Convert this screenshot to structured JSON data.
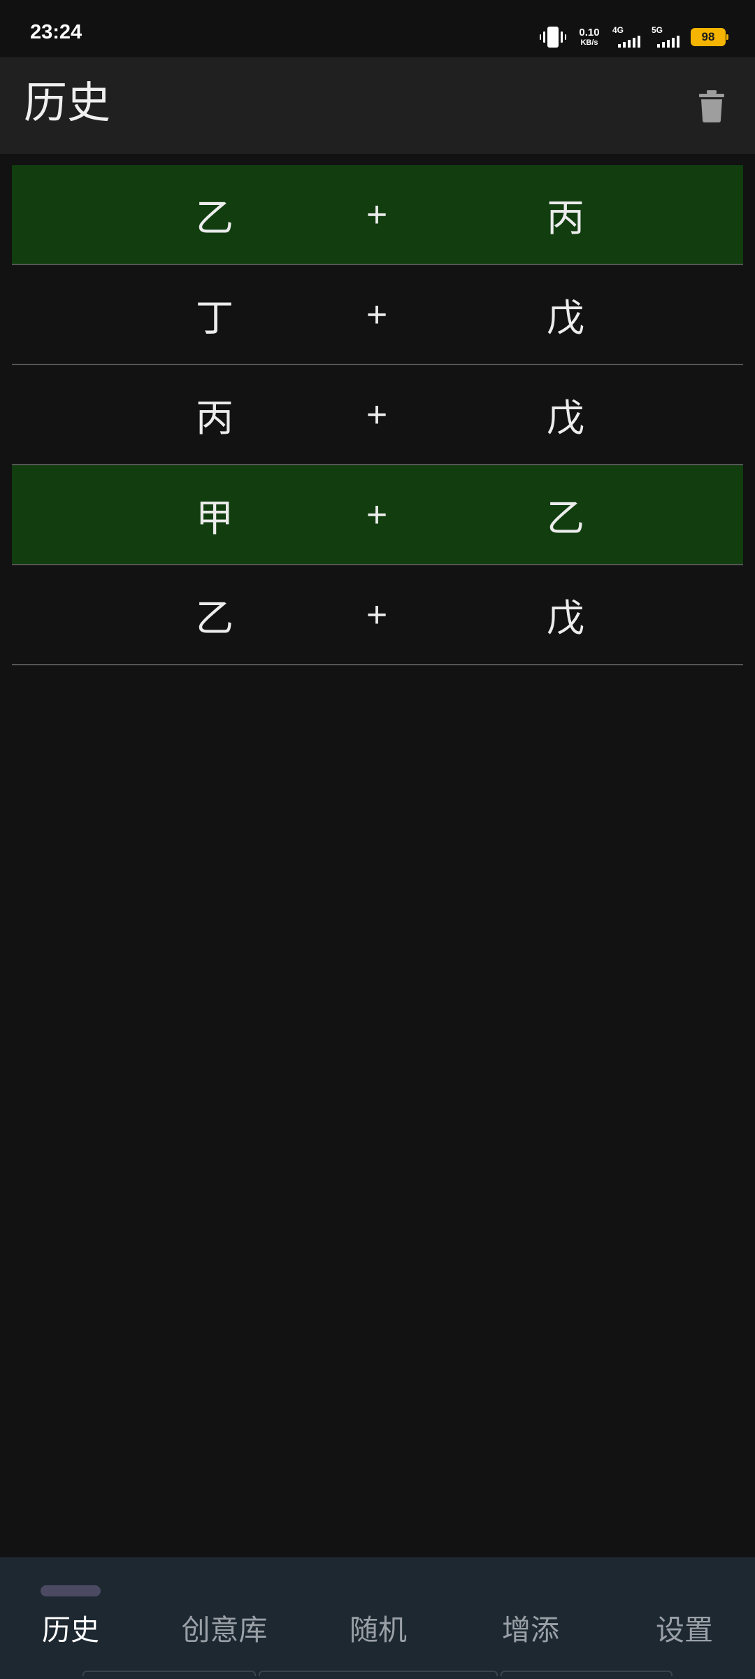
{
  "status_bar": {
    "time": "23:24",
    "net_speed_value": "0.10",
    "net_speed_unit": "KB/s",
    "signal_1_label": "4G",
    "signal_2_label": "5G",
    "battery_level": "98",
    "battery_color": "#f5b400",
    "icons": [
      "vibrate-icon",
      "signal-4g-icon",
      "signal-5g-icon",
      "battery-icon"
    ]
  },
  "header": {
    "title": "历史",
    "action_icon": "trash-icon"
  },
  "history": {
    "rows": [
      {
        "left": "乙",
        "op": "+",
        "right": "丙",
        "highlighted": true
      },
      {
        "left": "丁",
        "op": "+",
        "right": "戊",
        "highlighted": false
      },
      {
        "left": "丙",
        "op": "+",
        "right": "戊",
        "highlighted": false
      },
      {
        "left": "甲",
        "op": "+",
        "right": "乙",
        "highlighted": true
      },
      {
        "left": "乙",
        "op": "+",
        "right": "戊",
        "highlighted": false
      }
    ],
    "highlight_color": "#113d0f"
  },
  "bottom_nav": {
    "items": [
      {
        "label": "历史",
        "active": true
      },
      {
        "label": "创意库",
        "active": false
      },
      {
        "label": "随机",
        "active": false
      },
      {
        "label": "增添",
        "active": false
      },
      {
        "label": "设置",
        "active": false
      }
    ]
  }
}
